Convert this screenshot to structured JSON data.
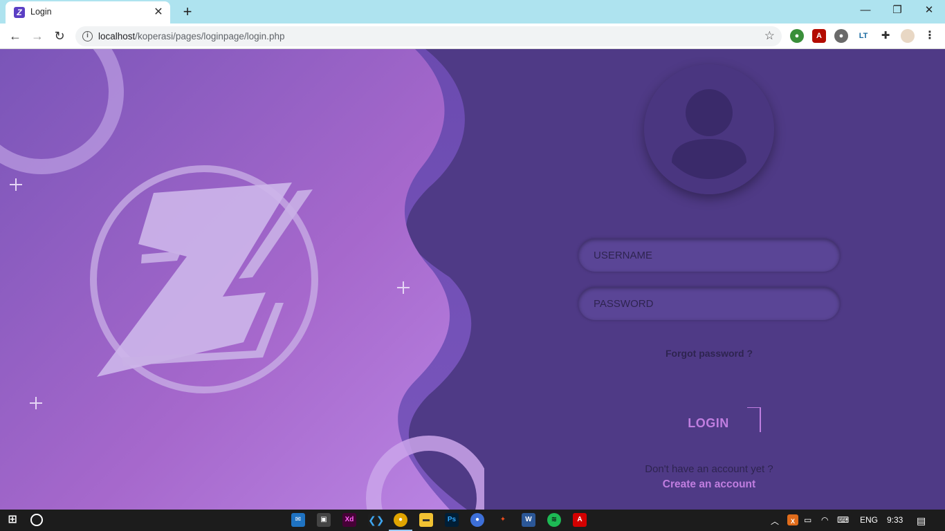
{
  "browser": {
    "tab_title": "Login",
    "url_host": "localhost",
    "url_path": "/koperasi/pages/loginpage/login.php"
  },
  "icons": [
    "z-logo-favicon",
    "back-arrow-icon",
    "forward-arrow-icon",
    "reload-icon",
    "info-icon",
    "star-icon",
    "extensions-puzzle-icon",
    "profile-avatar-icon",
    "kebab-menu-icon",
    "user-avatar-icon",
    "windows-start-icon",
    "cortana-circle-icon"
  ],
  "login_form": {
    "username_placeholder": "USERNAME",
    "password_placeholder": "PASSWORD",
    "forgot_password": "Forgot password ?",
    "login_button": "LOGIN",
    "no_account_text": "Don't have an account yet ?",
    "create_account_link": "Create an account"
  },
  "taskbar": {
    "language": "ENG",
    "time": "9:33",
    "apps": [
      "Mail",
      "Store",
      "Xd",
      "VS Code",
      "Chrome",
      "File Explorer",
      "Ps",
      "Firefox",
      "Figma",
      "Word",
      "Spotify",
      "Acrobat"
    ]
  },
  "colors": {
    "page_background": "#4f3a86",
    "accent": "#c07ee0",
    "hero_gradient_start": "#7a55b8",
    "hero_gradient_end": "#b47be0"
  }
}
